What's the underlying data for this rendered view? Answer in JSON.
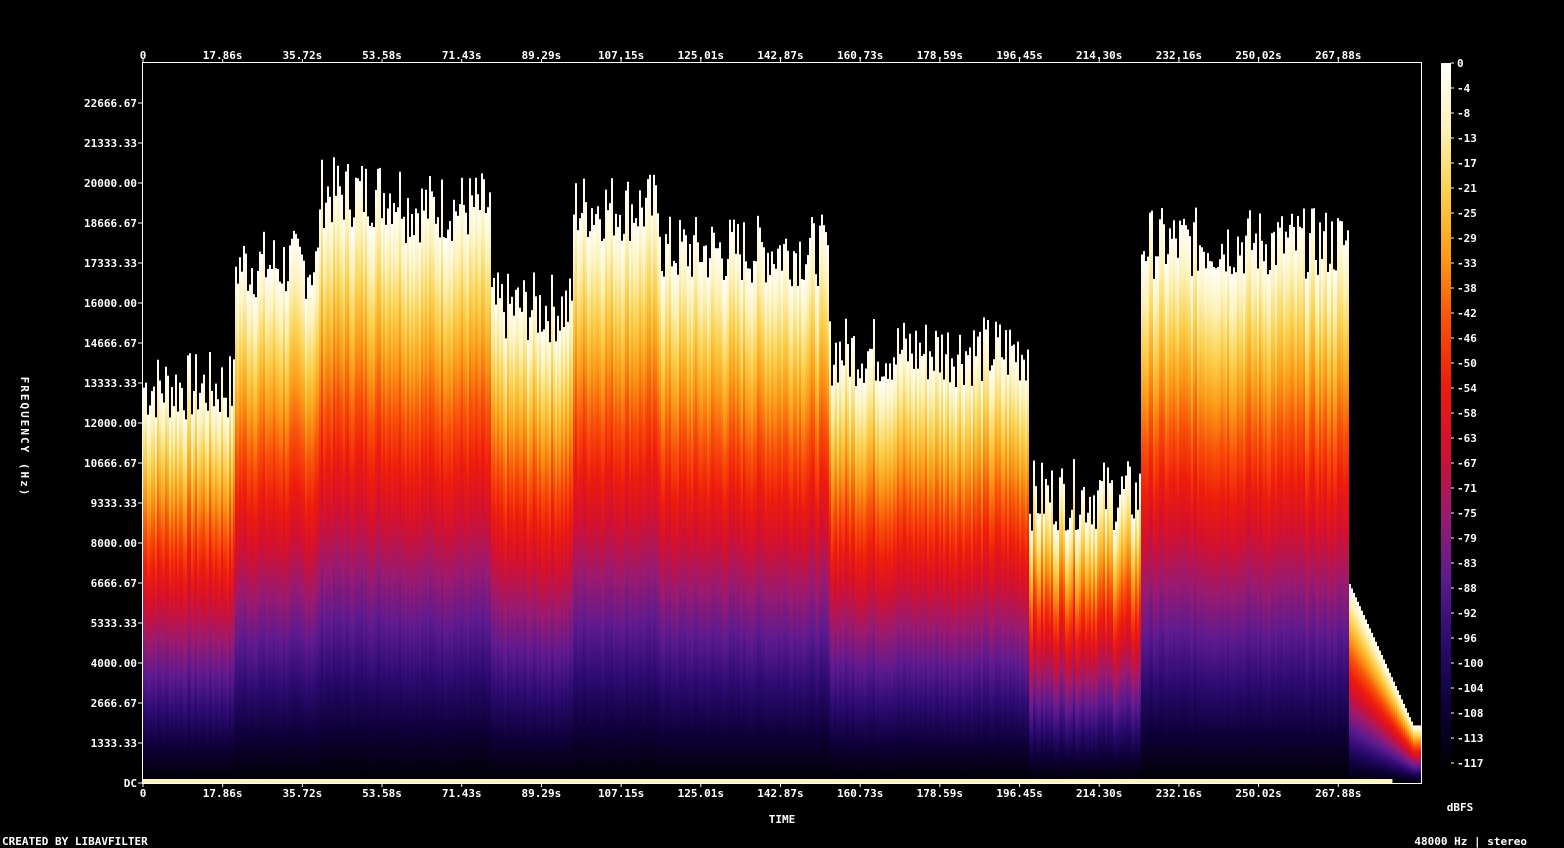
{
  "chart_data": {
    "type": "heatmap",
    "title": "",
    "xlabel": "TIME",
    "ylabel": "FREQUENCY (Hz)",
    "x_ticks": [
      "0",
      "17.86s",
      "35.72s",
      "53.58s",
      "71.43s",
      "89.29s",
      "107.15s",
      "125.01s",
      "142.87s",
      "160.73s",
      "178.59s",
      "196.45s",
      "214.30s",
      "232.16s",
      "250.02s",
      "267.88s"
    ],
    "x_range_seconds": [
      0,
      286.4
    ],
    "y_ticks": [
      "DC",
      "1333.33",
      "2666.67",
      "4000.00",
      "5333.33",
      "6666.67",
      "8000.00",
      "9333.33",
      "10666.67",
      "12000.00",
      "13333.33",
      "14666.67",
      "16000.00",
      "17333.33",
      "18666.67",
      "20000.00",
      "21333.33",
      "22666.67"
    ],
    "y_range_hz": [
      0,
      24000
    ],
    "colorbar": {
      "label": "dBFS",
      "ticks": [
        "0",
        "-4",
        "-8",
        "-13",
        "-17",
        "-21",
        "-25",
        "-29",
        "-33",
        "-38",
        "-42",
        "-46",
        "-50",
        "-54",
        "-58",
        "-63",
        "-67",
        "-71",
        "-75",
        "-79",
        "-83",
        "-88",
        "-92",
        "-96",
        "-100",
        "-104",
        "-108",
        "-113",
        "-117"
      ],
      "range_db": [
        -120,
        0
      ],
      "colors": [
        "#000000",
        "#0d0038",
        "#2a0a6e",
        "#5c1a90",
        "#9a1a70",
        "#d21030",
        "#ee1c0c",
        "#f8500a",
        "#fb9a18",
        "#fcd04c",
        "#fdf2b8",
        "#ffffff"
      ]
    },
    "segments": [
      {
        "start_s": 0,
        "level": 0.55
      },
      {
        "start_s": 20.2,
        "level": 0.72
      },
      {
        "start_s": 39.2,
        "level": 0.82
      },
      {
        "start_s": 58.3,
        "level": 0.8
      },
      {
        "start_s": 77.7,
        "level": 0.66
      },
      {
        "start_s": 96.1,
        "level": 0.8
      },
      {
        "start_s": 115.7,
        "level": 0.74
      },
      {
        "start_s": 153.6,
        "level": 0.6
      },
      {
        "start_s": 198.3,
        "level": 0.4
      },
      {
        "start_s": 223.3,
        "level": 0.75
      },
      {
        "start_s": 270.0,
        "level": 0.28
      }
    ],
    "footer_left": "CREATED BY LIBAVFILTER",
    "footer_right": "48000 Hz | stereo"
  }
}
